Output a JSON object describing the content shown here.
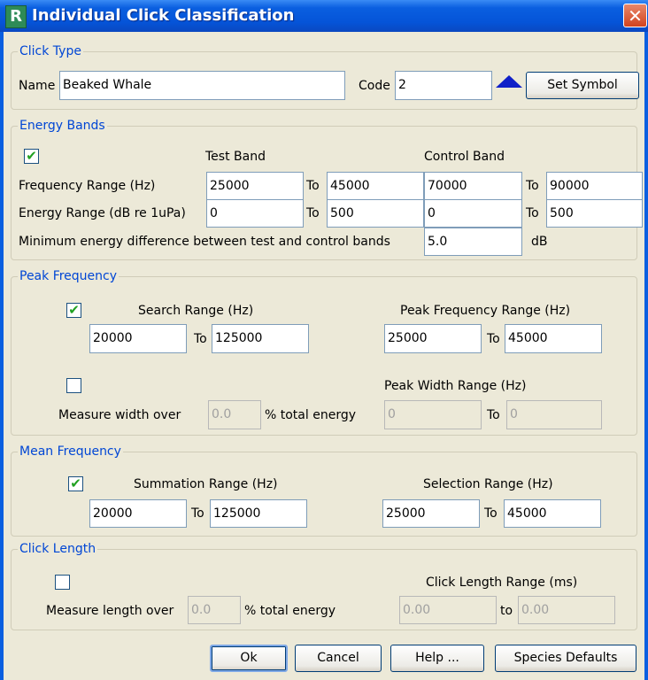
{
  "window": {
    "title": "Individual Click Classification",
    "close_glyph": "✕",
    "icon_letter": "R"
  },
  "click_type": {
    "legend": "Click Type",
    "name_label": "Name",
    "name_value": "Beaked Whale",
    "code_label": "Code",
    "code_value": "2",
    "symbol_color": "#1020C8",
    "set_symbol": "Set Symbol"
  },
  "energy_bands": {
    "legend": "Energy Bands",
    "enabled": true,
    "test_band": "Test Band",
    "control_band": "Control Band",
    "freq_label": "Frequency Range (Hz)",
    "freq_test_from": "25000",
    "freq_test_to": "45000",
    "freq_ctrl_from": "70000",
    "freq_ctrl_to": "90000",
    "energy_label": "Energy Range (dB re 1uPa)",
    "energy_test_from": "0",
    "energy_test_to": "500",
    "energy_ctrl_from": "0",
    "energy_ctrl_to": "500",
    "to": "To",
    "min_diff_label": "Minimum energy difference between test and control bands",
    "min_diff_value": "5.0",
    "db": "dB"
  },
  "peak_frequency": {
    "legend": "Peak Frequency",
    "search_enabled": true,
    "search_label": "Search Range (Hz)",
    "search_from": "20000",
    "search_to": "125000",
    "peak_range_label": "Peak Frequency Range (Hz)",
    "peak_from": "25000",
    "peak_to": "45000",
    "width_enabled": false,
    "width_range_label": "Peak Width Range (Hz)",
    "measure_label": "Measure width over",
    "measure_value": "0.0",
    "pct_label": "% total energy",
    "width_from": "0",
    "width_to": "0",
    "to": "To"
  },
  "mean_frequency": {
    "legend": "Mean Frequency",
    "enabled": true,
    "sum_label": "Summation Range (Hz)",
    "sum_from": "20000",
    "sum_to": "125000",
    "sel_label": "Selection Range (Hz)",
    "sel_from": "25000",
    "sel_to": "45000",
    "to": "To"
  },
  "click_length": {
    "legend": "Click Length",
    "enabled": false,
    "range_label": "Click Length Range (ms)",
    "measure_label": "Measure length over",
    "measure_value": "0.0",
    "pct_label": "% total energy",
    "from": "0.00",
    "to_value": "0.00",
    "to": "to"
  },
  "buttons": {
    "ok": "Ok",
    "cancel": "Cancel",
    "help": "Help ...",
    "defaults": "Species Defaults"
  },
  "check_glyph": "✔"
}
